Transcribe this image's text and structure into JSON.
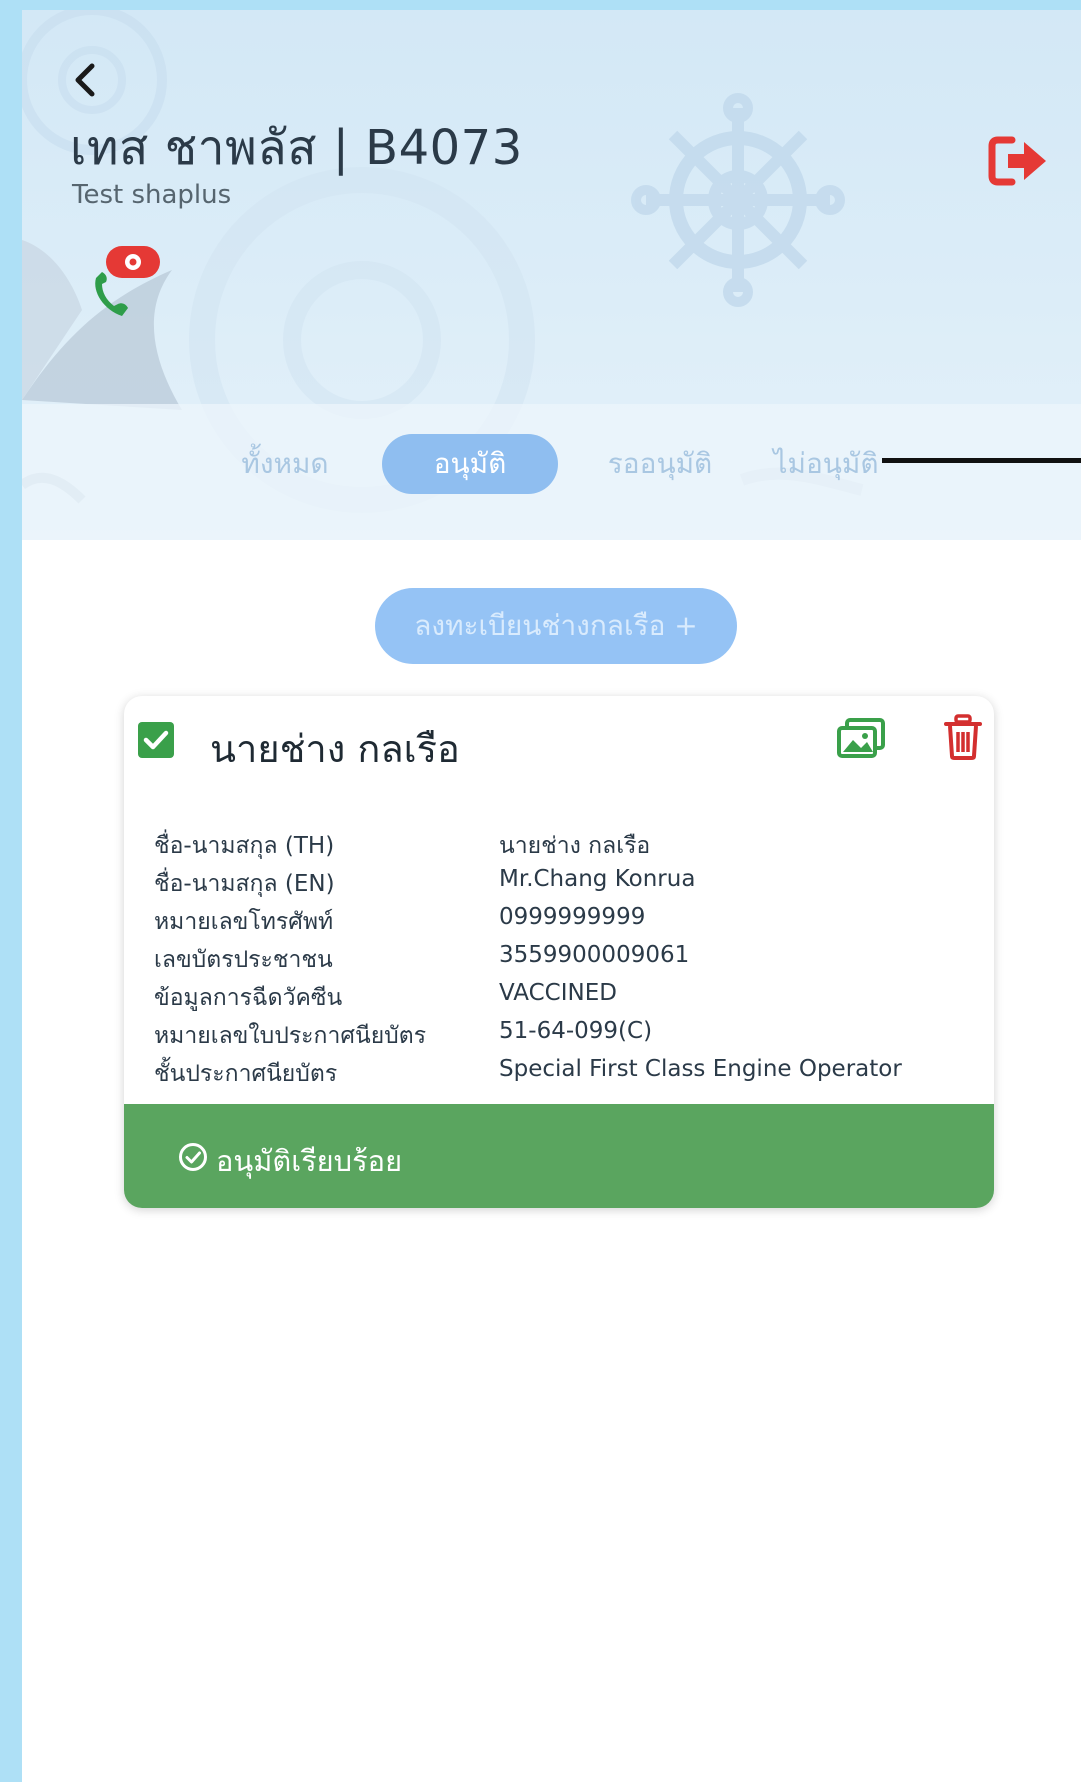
{
  "header": {
    "title": "เทส ชาพลัส | B4073",
    "subtitle": "Test shaplus",
    "icons": [
      "back-icon",
      "logout-icon",
      "phone-settings-icon"
    ],
    "colors": {
      "logout": "#e53935",
      "phone": "#2e9d4a",
      "badge": "#e53935"
    }
  },
  "tabs": [
    {
      "label": "ทั้งหมด",
      "active": false
    },
    {
      "label": "อนุมัติ",
      "active": true
    },
    {
      "label": "รออนุมัติ",
      "active": false
    },
    {
      "label": "ไม่อนุมัติ",
      "active": false
    }
  ],
  "register_button": {
    "label": "ลงทะเบียนช่างกลเรือ +"
  },
  "card": {
    "name": "นายช่าง กลเรือ",
    "checked": true,
    "rows": [
      {
        "label": "ชื่อ-นามสกุล (TH)",
        "value": "นายช่าง กลเรือ"
      },
      {
        "label": "ชื่อ-นามสกุล (EN)",
        "value": "Mr.Chang Konrua"
      },
      {
        "label": "หมายเลขโทรศัพท์",
        "value": "0999999999"
      },
      {
        "label": "เลขบัตรประชาชน",
        "value": "3559900009061"
      },
      {
        "label": "ข้อมูลการฉีดวัคซีน",
        "value": "VACCINED"
      },
      {
        "label": "หมายเลขใบประกาศนียบัตร",
        "value": "51-64-099(C)"
      },
      {
        "label": "ชั้นประกาศนียบัตร",
        "value": "Special First Class Engine Operator"
      }
    ],
    "status": "อนุมัติเรียบร้อย",
    "colors": {
      "status_bar": "#5aa55f",
      "checkbox": "#3aa04a",
      "trash": "#d32f2f",
      "image_icon": "#3aa04a"
    }
  },
  "colors": {
    "accent": "#8fbef0",
    "page_border": "#aee0f6"
  }
}
